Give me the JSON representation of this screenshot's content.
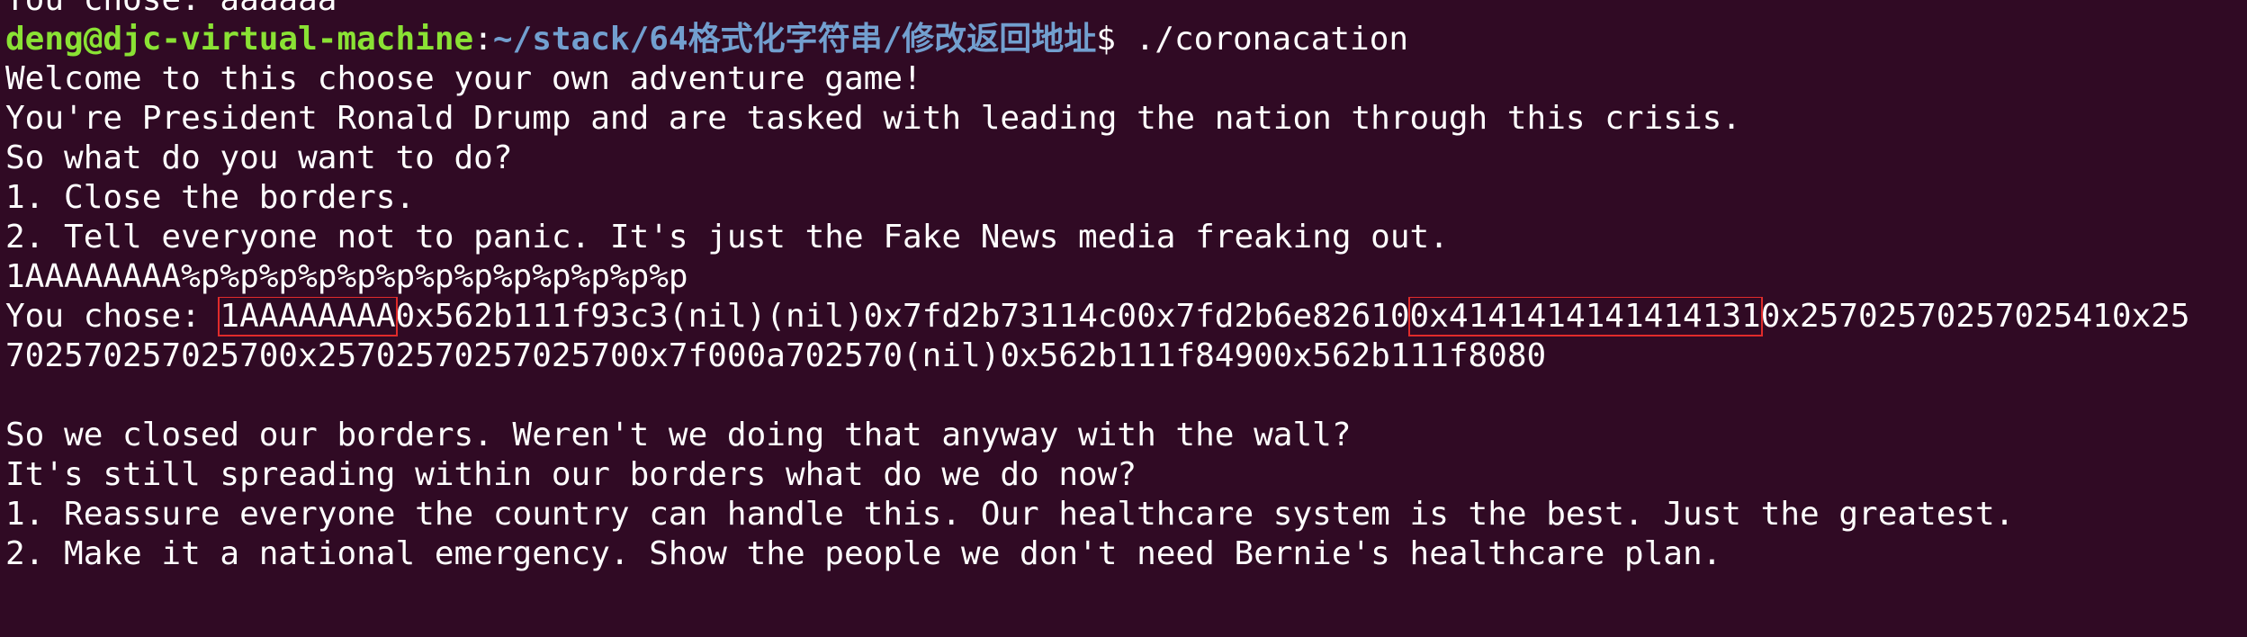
{
  "terminal": {
    "background": "#300a24",
    "foreground": "#ffffff",
    "prompt_user_color": "#8ae234",
    "prompt_path_color": "#729fcf",
    "highlight_color": "#e02b2b"
  },
  "lines": {
    "l0": "You chose: aaaaaa",
    "prompt_user": "deng@djc-virtual-machine",
    "prompt_sep": ":",
    "prompt_path": "~/stack/64格式化字符串/修改返回地址",
    "prompt_cmd": "$ ./coronacation",
    "l2": "Welcome to this choose your own adventure game!",
    "l3": "You're President Ronald Drump and are tasked with leading the nation through this crisis.",
    "l4": "So what do you want to do?",
    "l5": "1. Close the borders.",
    "l6": "2. Tell everyone not to panic. It's just the Fake News media freaking out.",
    "l7": "1AAAAAAAA%p%p%p%p%p%p%p%p%p%p%p%p%p",
    "l8_prefix": "You chose: ",
    "l8_hl1": "1AAAAAAAA",
    "l8_mid": "0x562b111f93c3(nil)(nil)0x7fd2b73114c00x7fd2b6e82610",
    "l8_hl2": "0x4141414141414131",
    "l8_suffix": "0x25702570257025410x25",
    "l9": "702570257025700x25702570257025700x7f000a702570(nil)0x562b111f84900x562b111f8080",
    "l11": "So we closed our borders. Weren't we doing that anyway with the wall?",
    "l12": "It's still spreading within our borders what do we do now?",
    "l13": "1. Reassure everyone the country can handle this. Our healthcare system is the best. Just the greatest.",
    "l14": "2. Make it a national emergency. Show the people we don't need Bernie's healthcare plan."
  }
}
